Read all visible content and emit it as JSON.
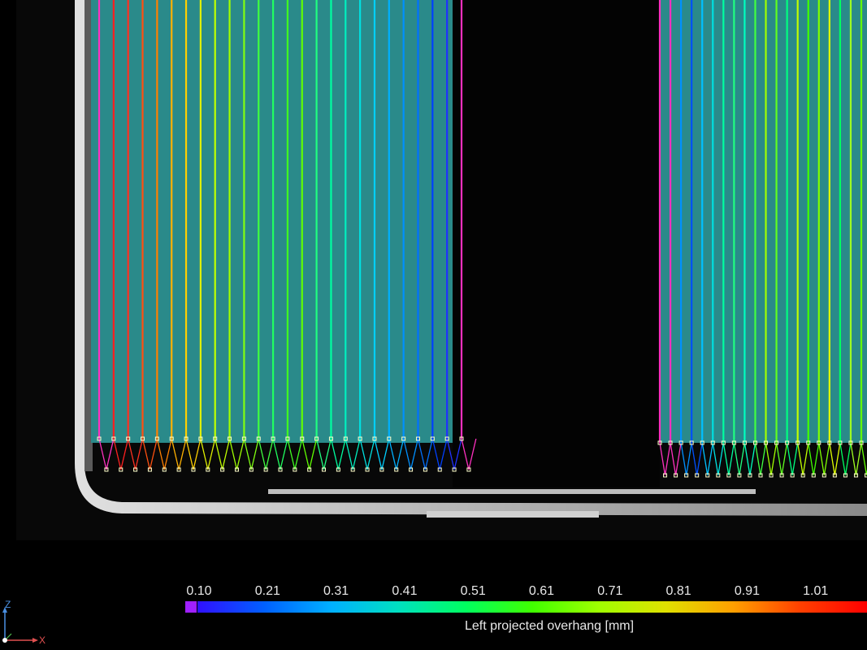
{
  "scale": {
    "title": "Left projected overhang [mm]",
    "ticks": [
      "0.10",
      "0.21",
      "0.31",
      "0.41",
      "0.51",
      "0.61",
      "0.71",
      "0.81",
      "0.91",
      "1.01"
    ],
    "colormap": [
      "#3010ff",
      "#0060ff",
      "#00b0ff",
      "#00e0c0",
      "#00ff60",
      "#40ff00",
      "#a0ff00",
      "#e0e000",
      "#ffa000",
      "#ff4000",
      "#ff0000"
    ],
    "nan_color": "#a020ff"
  },
  "axes": {
    "z": "Z",
    "x": "X",
    "z_color": "#4a90e2",
    "x_color": "#e05050"
  },
  "colors": {
    "background": "#000000",
    "casing": "#c8c8c8",
    "electrode": "#2a8a8a",
    "tab_magenta": "#ff30c0",
    "connector": "#ffffff"
  },
  "left_stack_lines": [
    "#ff30c0",
    "#ff2020",
    "#ff3020",
    "#ff5010",
    "#ff8000",
    "#ffb000",
    "#ffd000",
    "#e0f000",
    "#c0ff00",
    "#a0ff00",
    "#80ff10",
    "#40ff40",
    "#20ff60",
    "#40ff20",
    "#60ff00",
    "#20ff80",
    "#00ffa0",
    "#00f0c0",
    "#00e0e0",
    "#00d0ff",
    "#00b0ff",
    "#0090ff",
    "#0070ff",
    "#0040ff",
    "#2030ff",
    "#ff30c0"
  ],
  "right_stack_lines": [
    "#ff30c0",
    "#ff30c0",
    "#0090ff",
    "#0050ff",
    "#00c0ff",
    "#00e0e0",
    "#00ffa0",
    "#20ff80",
    "#00ffc0",
    "#40ff40",
    "#a0ff00",
    "#60ff20",
    "#00ff80",
    "#c0ff00",
    "#40ff00",
    "#80ff00",
    "#e0ff00",
    "#00ff60",
    "#a0ff20",
    "#60ff00"
  ]
}
